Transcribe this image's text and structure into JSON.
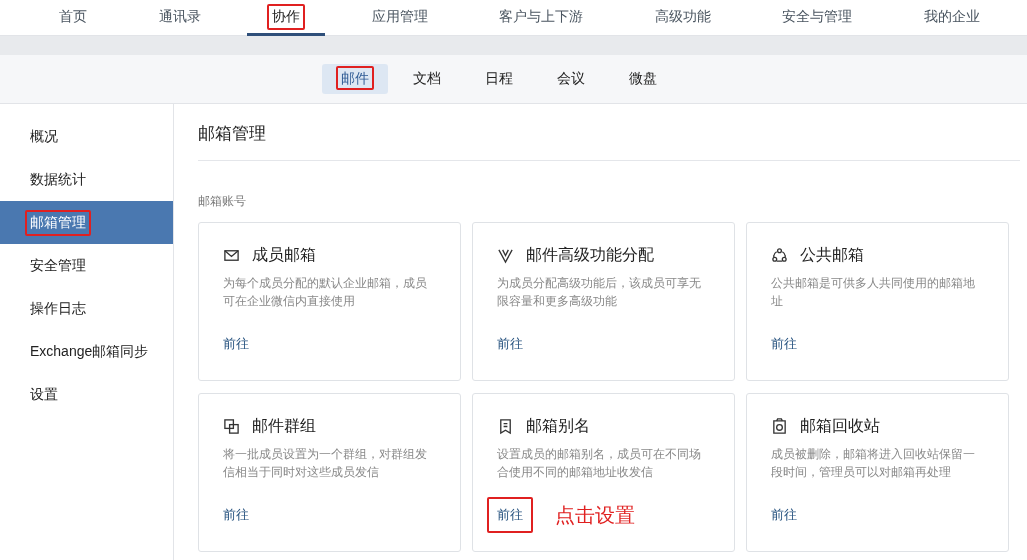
{
  "top_nav": [
    {
      "label": "首页",
      "selected": false,
      "highlighted": false
    },
    {
      "label": "通讯录",
      "selected": false,
      "highlighted": false
    },
    {
      "label": "协作",
      "selected": true,
      "highlighted": true
    },
    {
      "label": "应用管理",
      "selected": false,
      "highlighted": false
    },
    {
      "label": "客户与上下游",
      "selected": false,
      "highlighted": false
    },
    {
      "label": "高级功能",
      "selected": false,
      "highlighted": false
    },
    {
      "label": "安全与管理",
      "selected": false,
      "highlighted": false
    },
    {
      "label": "我的企业",
      "selected": false,
      "highlighted": false
    }
  ],
  "sub_nav": [
    {
      "label": "邮件",
      "selected": true,
      "highlighted": true
    },
    {
      "label": "文档",
      "selected": false,
      "highlighted": false
    },
    {
      "label": "日程",
      "selected": false,
      "highlighted": false
    },
    {
      "label": "会议",
      "selected": false,
      "highlighted": false
    },
    {
      "label": "微盘",
      "selected": false,
      "highlighted": false
    }
  ],
  "sidebar": {
    "items": [
      {
        "label": "概况",
        "selected": false,
        "highlighted": false
      },
      {
        "label": "数据统计",
        "selected": false,
        "highlighted": false
      },
      {
        "label": "邮箱管理",
        "selected": true,
        "highlighted": true
      },
      {
        "label": "安全管理",
        "selected": false,
        "highlighted": false
      },
      {
        "label": "操作日志",
        "selected": false,
        "highlighted": false
      },
      {
        "label": "Exchange邮箱同步",
        "selected": false,
        "highlighted": false
      },
      {
        "label": "设置",
        "selected": false,
        "highlighted": false
      }
    ]
  },
  "content": {
    "title": "邮箱管理",
    "section": "邮箱账号",
    "cards": [
      {
        "title": "成员邮箱",
        "description": "为每个成员分配的默认企业邮箱，成员可在企业微信内直接使用",
        "link": "前往",
        "highlighted": false
      },
      {
        "title": "邮件高级功能分配",
        "description": "为成员分配高级功能后，该成员可享无限容量和更多高级功能",
        "link": "前往",
        "highlighted": false
      },
      {
        "title": "公共邮箱",
        "description": "公共邮箱是可供多人共同使用的邮箱地址",
        "link": "前往",
        "highlighted": false
      },
      {
        "title": "邮件群组",
        "description": "将一批成员设置为一个群组，对群组发信相当于同时对这些成员发信",
        "link": "前往",
        "highlighted": false
      },
      {
        "title": "邮箱别名",
        "description": "设置成员的邮箱别名，成员可在不同场合使用不同的邮箱地址收发信",
        "link": "前往",
        "highlighted": true,
        "annotation": "点击设置"
      },
      {
        "title": "邮箱回收站",
        "description": "成员被删除，邮箱将进入回收站保留一段时间，管理员可以对邮箱再处理",
        "link": "前往",
        "highlighted": false
      }
    ]
  }
}
